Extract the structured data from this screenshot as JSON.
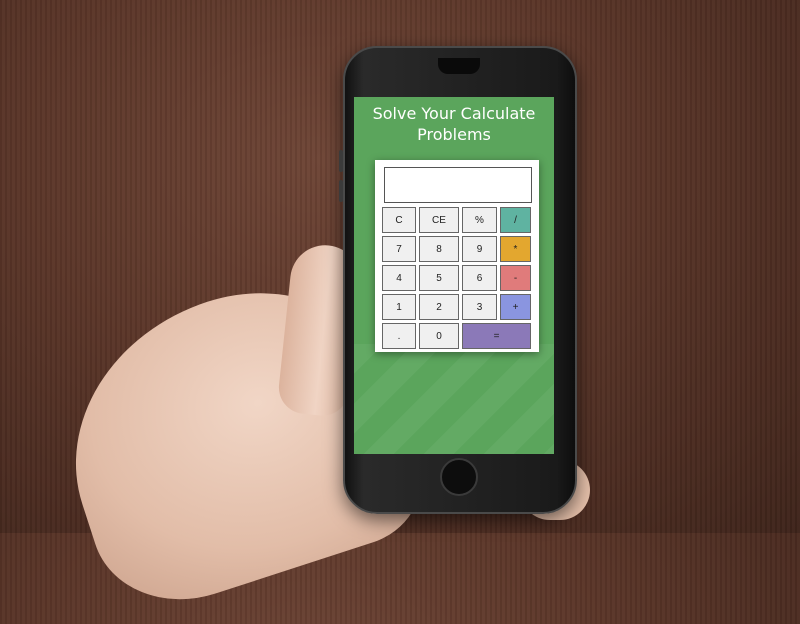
{
  "app": {
    "title": "Solve Your Calculate Problems"
  },
  "calculator": {
    "display_value": "",
    "keys": {
      "clear": "C",
      "clear_entry": "CE",
      "percent": "%",
      "divide": "/",
      "seven": "7",
      "eight": "8",
      "nine": "9",
      "multiply": "*",
      "four": "4",
      "five": "5",
      "six": "6",
      "subtract": "-",
      "one": "1",
      "two": "2",
      "three": "3",
      "add": "+",
      "decimal": ".",
      "zero": "0",
      "equals": "="
    },
    "colors": {
      "divide": "#5fb3a1",
      "multiply": "#e3a72f",
      "subtract": "#e07b7b",
      "add": "#8a95e0",
      "equals": "#8b79b8",
      "screen_background": "#5ba55c"
    }
  }
}
